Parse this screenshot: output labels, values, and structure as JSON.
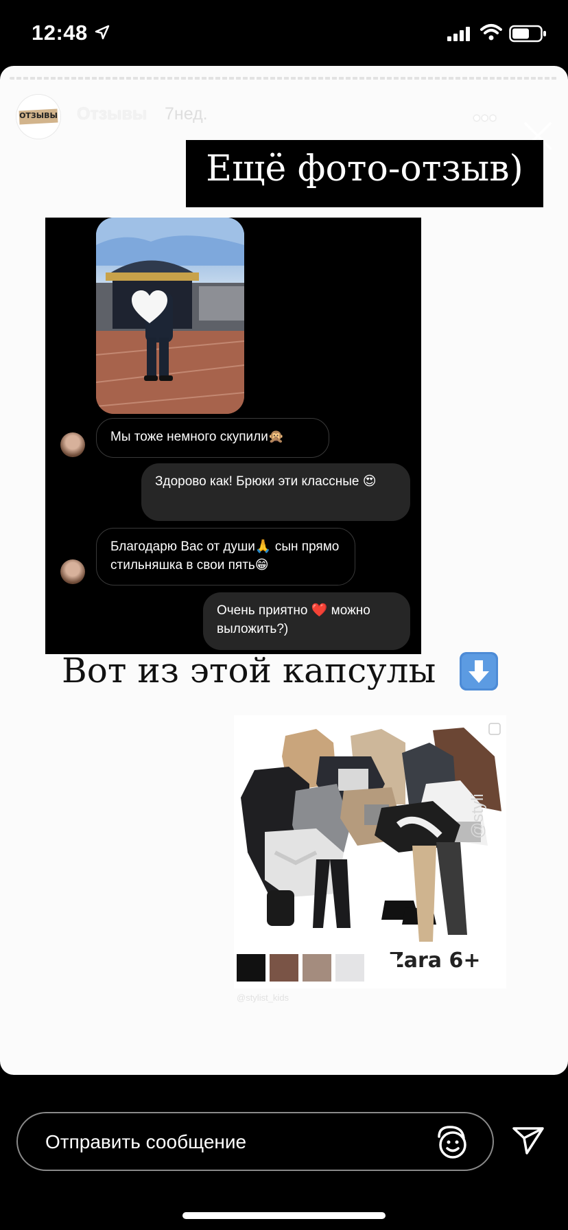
{
  "status_bar": {
    "time": "12:48"
  },
  "story": {
    "account_name": "Отзывы",
    "avatar_text": "ОТЗЫВЫ",
    "time_ago": "7нед.",
    "title": "Ещё фото-отзыв)",
    "chat": [
      {
        "side": "incoming",
        "text": "Мы тоже немного скупили🙊"
      },
      {
        "side": "outgoing",
        "text": "Здорово как! Брюки эти классные 😍"
      },
      {
        "side": "incoming",
        "text": "Благодарю Вас от души🙏 сын прямо стильняшка в свои пять😁"
      },
      {
        "side": "outgoing",
        "text": "Очень приятно ❤️ можно выложить?)"
      }
    ],
    "capsule_heading": "Вот из этой капсулы",
    "collage": {
      "brand_label": "Zara 6+",
      "side_watermark": "@styli",
      "swatches": [
        "#111111",
        "#7a5446",
        "#a48c7e",
        "#e4e4e6",
        "#ffffff"
      ],
      "credit": "@stylist_kids"
    }
  },
  "reply_bar": {
    "placeholder": "Отправить сообщение"
  },
  "icons": [
    "location-arrow-icon",
    "signal-icon",
    "wifi-icon",
    "battery-icon",
    "more-icon",
    "close-icon",
    "heart-icon",
    "arrow-down-icon",
    "emoji-icon",
    "send-icon"
  ]
}
